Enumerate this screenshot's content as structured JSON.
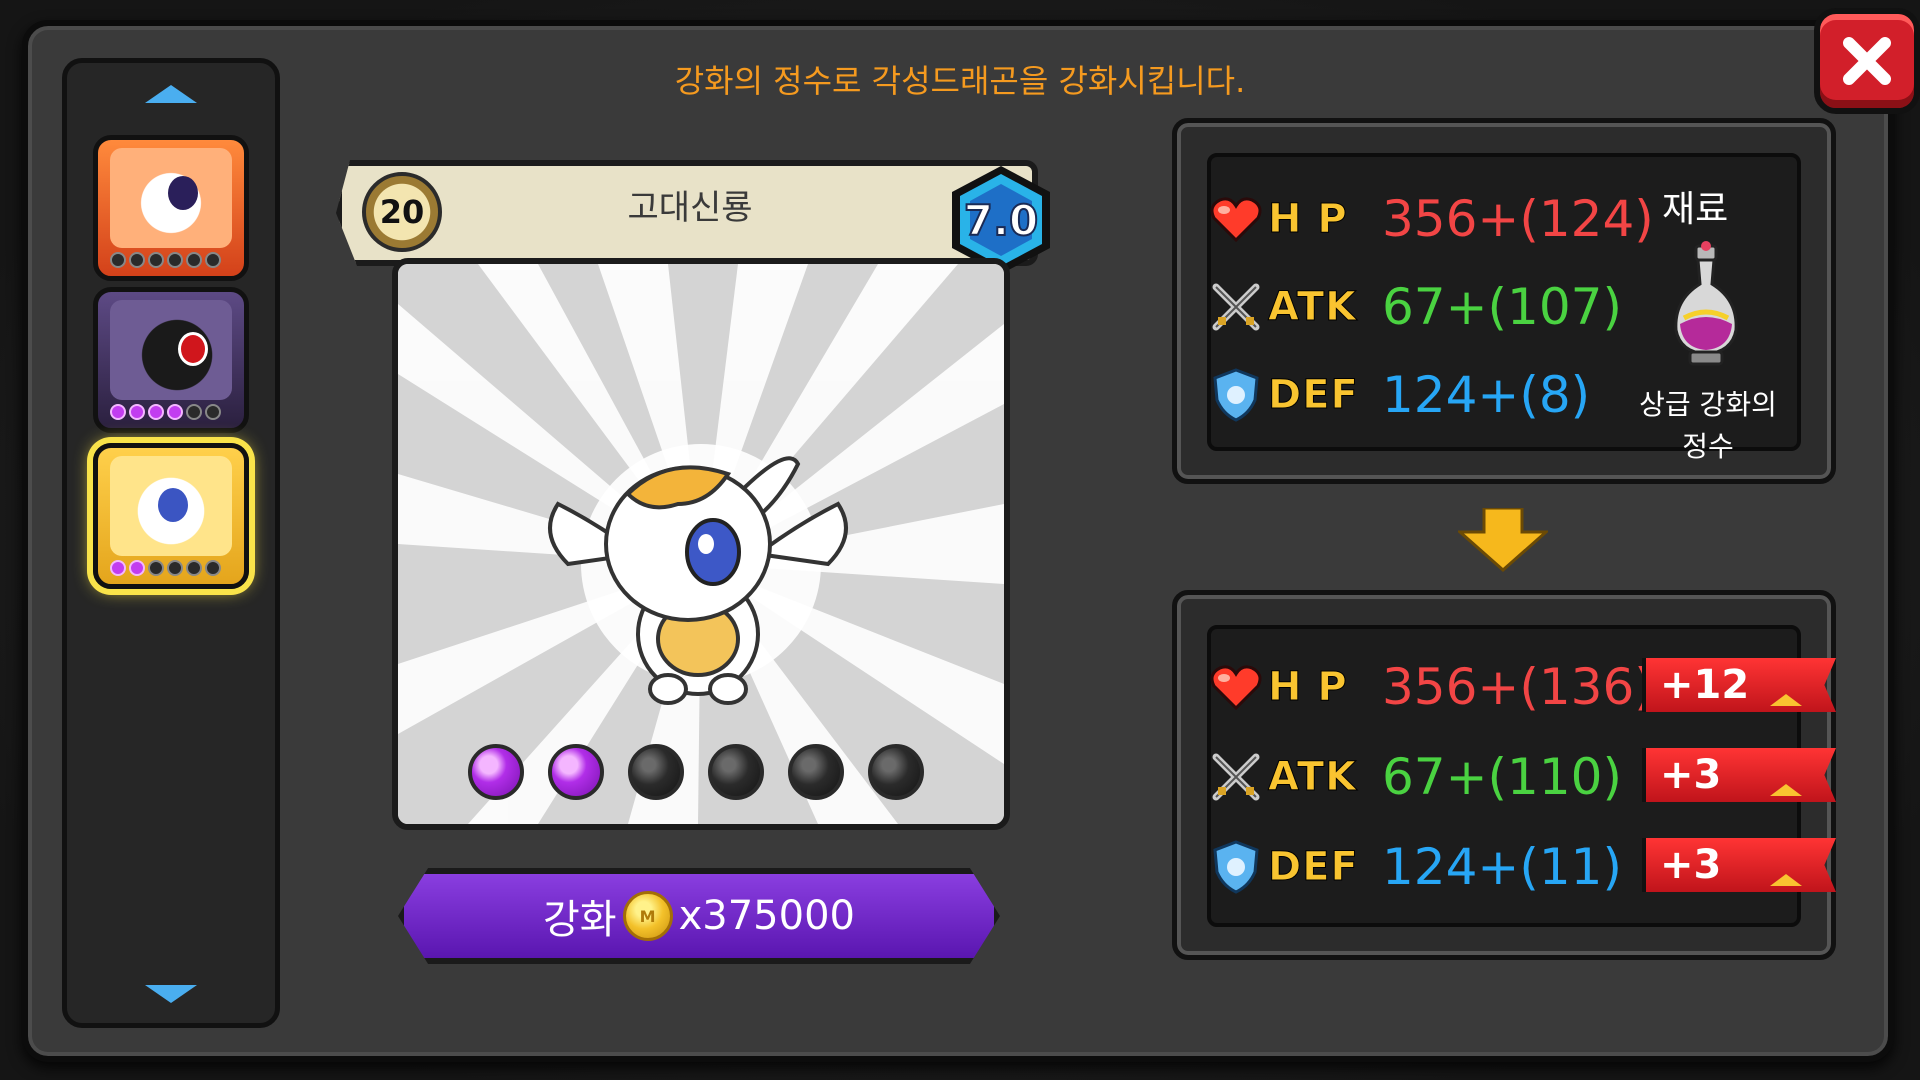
{
  "instruction": "강화의 정수로 각성드래곤을 강화시킵니다.",
  "dragon": {
    "level": "20",
    "name": "고대신룡",
    "grade": "7.0",
    "gems_filled": 2,
    "gems_total": 6
  },
  "roster": {
    "slots": [
      {
        "name": "fire-dragon",
        "stars_filled": 0,
        "stars_total": 6
      },
      {
        "name": "dark-dragon",
        "stars_filled": 4,
        "stars_total": 6
      },
      {
        "name": "ancient-divine-dragon",
        "stars_filled": 2,
        "stars_total": 6,
        "selected": true
      }
    ]
  },
  "upgrade_button": {
    "label": "강화",
    "cost": "x375000"
  },
  "current_stats": {
    "hp_label": "H P",
    "hp_value": "356+(124)",
    "atk_label": "ATK",
    "atk_value": "67+(107)",
    "def_label": "DEF",
    "def_value": "124+(8)"
  },
  "material": {
    "title": "재료",
    "name": "상급 강화의 정수"
  },
  "result_stats": {
    "hp_label": "H P",
    "hp_value": "356+(136)",
    "hp_bonus": "+12",
    "atk_label": "ATK",
    "atk_value": "67+(110)",
    "atk_bonus": "+3",
    "def_label": "DEF",
    "def_value": "124+(11)",
    "def_bonus": "+3"
  },
  "colors": {
    "instruction": "#f59a1f",
    "hp": "#f24545",
    "atk": "#4ad241",
    "def": "#27a6f5",
    "stat_label": "#f9c430",
    "upgrade_button": "#7a2ed0",
    "bonus_tag": "#e0202a"
  }
}
